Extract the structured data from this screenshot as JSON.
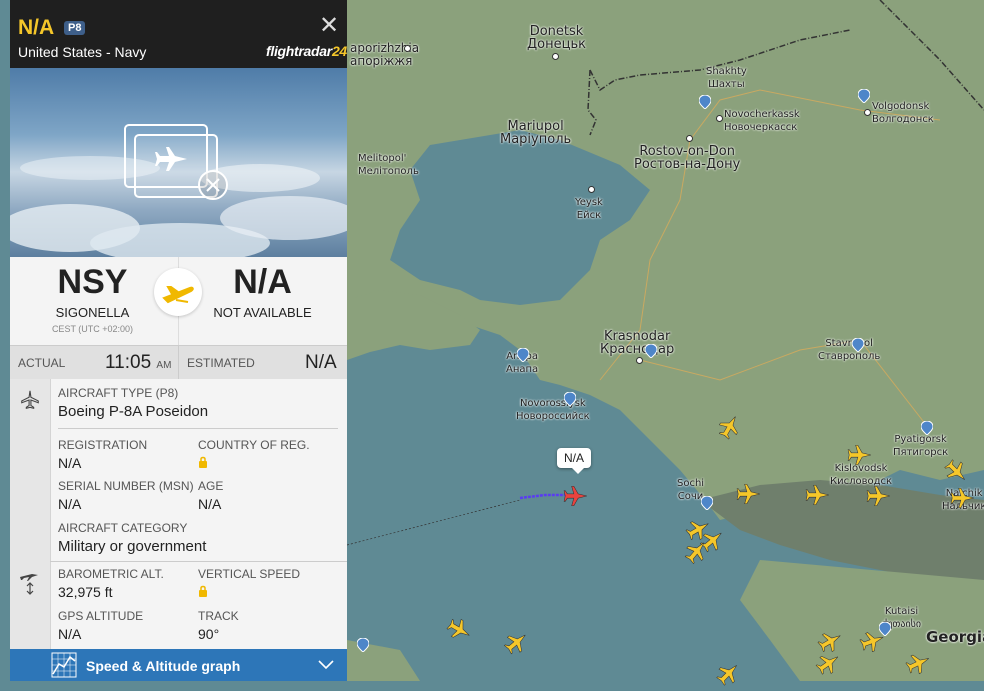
{
  "flight": {
    "callsign": "N/A",
    "type_badge": "P8",
    "operator": "United States - Navy",
    "brand_main": "flightradar",
    "brand_accent": "24",
    "close_glyph": "✕"
  },
  "route": {
    "origin": {
      "code": "NSY",
      "name": "SIGONELLA",
      "tz": "CEST (UTC +02:00)"
    },
    "destination": {
      "code": "N/A",
      "name": "NOT AVAILABLE"
    }
  },
  "times": {
    "actual_label": "ACTUAL",
    "actual_value": "11:05",
    "actual_ampm": "AM",
    "estimated_label": "ESTIMATED",
    "estimated_value": "N/A"
  },
  "details": {
    "aircraft_type_label": "AIRCRAFT TYPE (P8)",
    "aircraft_type_value": "Boeing P-8A Poseidon",
    "registration_label": "REGISTRATION",
    "registration_value": "N/A",
    "country_label": "COUNTRY OF REG.",
    "serial_label": "SERIAL NUMBER (MSN)",
    "serial_value": "N/A",
    "age_label": "AGE",
    "age_value": "N/A",
    "category_label": "AIRCRAFT CATEGORY",
    "category_value": "Military or government",
    "baro_label": "BAROMETRIC ALT.",
    "baro_value": "32,975 ft",
    "vspeed_label": "VERTICAL SPEED",
    "gps_label": "GPS ALTITUDE",
    "gps_value": "N/A",
    "track_label": "TRACK",
    "track_value": "90°"
  },
  "graph_bar": {
    "label": "Speed & Altitude graph"
  },
  "map": {
    "flight_label": "N/A",
    "cities": [
      {
        "en": "Donetsk",
        "local": "Донецьк"
      },
      {
        "en": "Shakhty",
        "local": "Шахты"
      },
      {
        "en": "Novocherkassk",
        "local": "Новочеркасск"
      },
      {
        "en": "Volgodonsk",
        "local": "Волгодонск"
      },
      {
        "en": "Mariupol",
        "local": "Маріуполь"
      },
      {
        "en": "Rostov-on-Don",
        "local": "Ростов-на-Дону"
      },
      {
        "en": "Melitopol'",
        "local": "Мелітополь"
      },
      {
        "en": "Yeysk",
        "local": "Ейск"
      },
      {
        "en": "Krasnodar",
        "local": "Краснодар"
      },
      {
        "en": "Stavropol",
        "local": "Ставрополь"
      },
      {
        "en": "Anapa",
        "local": "Анапа"
      },
      {
        "en": "Novorossiysk",
        "local": "Новороссийск"
      },
      {
        "en": "Sochi",
        "local": "Сочи"
      },
      {
        "en": "Kislovodsk",
        "local": "Кисловодск"
      },
      {
        "en": "Pyatigorsk",
        "local": "Пятигорск"
      },
      {
        "en": "Nalchik",
        "local": "Нальчик"
      },
      {
        "en": "Kutaisi",
        "local": "ქუთაისი"
      },
      {
        "en": "Georgia",
        "local": ""
      },
      {
        "en": "aporizhzhia",
        "local": "апоріжжя"
      }
    ]
  },
  "colors": {
    "accent": "#f5c72a",
    "header_bg": "#1f1f1f",
    "bar_blue": "#2d76b8",
    "sea": "#5f8a94",
    "land": "#8ba17c"
  }
}
